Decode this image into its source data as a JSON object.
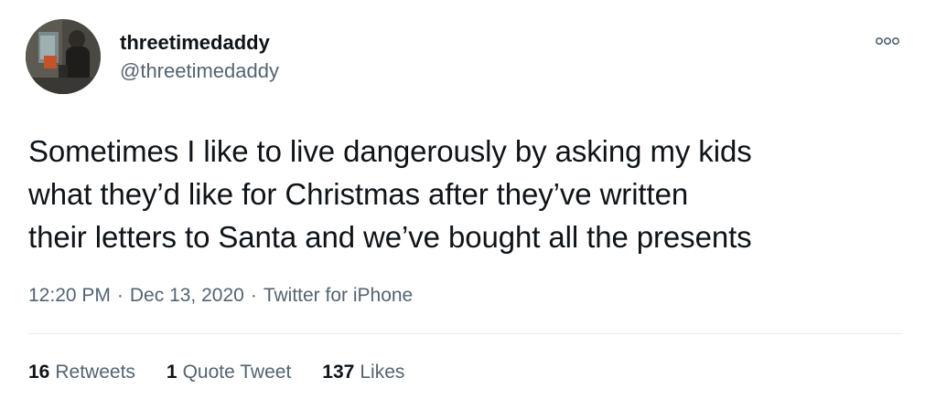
{
  "tweet": {
    "author": {
      "display_name": "threetimedaddy",
      "handle": "@threetimedaddy",
      "avatar_icon": "profile-photo"
    },
    "more_icon": "more-options-icon",
    "text_lines": [
      "Sometimes I like to live dangerously by asking my kids",
      "what they’d like for Christmas after they’ve written",
      "their letters to Santa and we’ve bought all the presents"
    ],
    "meta": {
      "time": "12:20 PM",
      "separator": "·",
      "date": "Dec 13, 2020",
      "source": "Twitter for iPhone"
    },
    "stats": {
      "retweets": {
        "count": "16",
        "label": "Retweets"
      },
      "quote_tweets": {
        "count": "1",
        "label": "Quote Tweet"
      },
      "likes": {
        "count": "137",
        "label": "Likes"
      }
    }
  },
  "colors": {
    "text_primary": "#0f1419",
    "text_secondary": "#536471",
    "divider": "#e6ecf0"
  }
}
